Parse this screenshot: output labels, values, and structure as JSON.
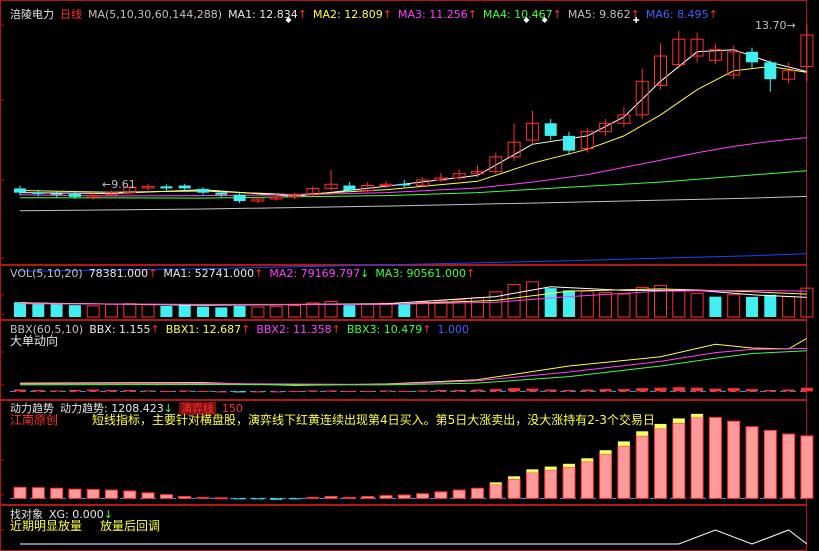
{
  "colors": {
    "bg": "#000000",
    "frame": "#b01818",
    "up": "#ff3030",
    "down": "#40f0f0",
    "ma1": "#ffffff",
    "ma2": "#ffff40",
    "ma3": "#ff40ff",
    "ma4": "#40ff40",
    "ma5": "#c0c0c0",
    "ma6": "#2040ff",
    "label_white": "#e8e8e8"
  },
  "price_panel": {
    "stock_name": "涪陵电力",
    "period": "日线",
    "ma_params": "MA(5,10,30,60,144,288)",
    "ma1": {
      "label": "MA1:",
      "value": "12.834",
      "arrow": "↑"
    },
    "ma2": {
      "label": "MA2:",
      "value": "12.809",
      "arrow": "↑"
    },
    "ma3": {
      "label": "MA3:",
      "value": "11.256",
      "arrow": "↑"
    },
    "ma4": {
      "label": "MA4:",
      "value": "10.467",
      "arrow": "↑"
    },
    "ma5": {
      "label": "MA5:",
      "value": "9.862",
      "arrow": "↑"
    },
    "ma6": {
      "label": "MA6:",
      "value": "8.495",
      "arrow": "↑"
    },
    "high_label": "13.70",
    "low_label": "9.61"
  },
  "vol_panel": {
    "params": "VOL(5,10,20)",
    "volume": "78381.000",
    "volume_arrow": "↑",
    "ma1": {
      "label": "MA1:",
      "value": "52741.000",
      "arrow": "↑"
    },
    "ma2": {
      "label": "MA2:",
      "value": "79169.797",
      "arrow": "↓"
    },
    "ma3": {
      "label": "MA3:",
      "value": "90561.000",
      "arrow": "↑"
    }
  },
  "bbx_panel": {
    "params": "BBX(60,5,10)",
    "bbx": {
      "label": "BBX:",
      "value": "1.155",
      "arrow": "↑"
    },
    "bbx1": {
      "label": "BBX1:",
      "value": "12.687",
      "arrow": "↑"
    },
    "bbx2": {
      "label": "BBX2:",
      "value": "11.358",
      "arrow": "↑"
    },
    "bbx3": {
      "label": "BBX3:",
      "value": "10.479",
      "arrow": "↑"
    },
    "level": "1.000",
    "caption": "大单动向"
  },
  "momentum_panel": {
    "title": "动力趋势",
    "indicator_label": "动力趋势:",
    "indicator_value": "1208.423",
    "indicator_arrow": "↓",
    "evolve_label": "演弈线",
    "evolve_value": "150",
    "brand": "江南原创",
    "description": "短线指标，主要针对横盘股，演弈线下红黄连续出现第4日买入。第5日大涨卖出，没大涨持有2-3个交易日"
  },
  "find_panel": {
    "title": "找对象",
    "xg_label": "XG:",
    "xg_value": "0.000",
    "xg_arrow": "↓",
    "caption1": "近期明显放量",
    "caption2": "放量后回调"
  },
  "chart_data": {
    "type": "candlestick",
    "price_range": [
      8.3,
      14.2
    ],
    "candles": [
      {
        "o": 10.05,
        "c": 9.95,
        "h": 10.12,
        "l": 9.88
      },
      {
        "o": 9.96,
        "c": 9.92,
        "h": 10.02,
        "l": 9.86
      },
      {
        "o": 9.93,
        "c": 9.9,
        "h": 9.98,
        "l": 9.84
      },
      {
        "o": 9.92,
        "c": 9.85,
        "h": 9.98,
        "l": 9.8
      },
      {
        "o": 9.84,
        "c": 9.88,
        "h": 9.95,
        "l": 9.78
      },
      {
        "o": 9.9,
        "c": 9.95,
        "h": 10.0,
        "l": 9.86
      },
      {
        "o": 9.95,
        "c": 10.08,
        "h": 10.12,
        "l": 9.9
      },
      {
        "o": 10.06,
        "c": 10.1,
        "h": 10.16,
        "l": 10.0
      },
      {
        "o": 10.1,
        "c": 10.05,
        "h": 10.15,
        "l": 9.98
      },
      {
        "o": 10.12,
        "c": 10.05,
        "h": 10.16,
        "l": 9.96
      },
      {
        "o": 10.04,
        "c": 9.95,
        "h": 10.08,
        "l": 9.9
      },
      {
        "o": 9.95,
        "c": 9.9,
        "h": 10.0,
        "l": 9.84
      },
      {
        "o": 9.9,
        "c": 9.75,
        "h": 9.94,
        "l": 9.7
      },
      {
        "o": 9.75,
        "c": 9.8,
        "h": 9.86,
        "l": 9.7
      },
      {
        "o": 9.8,
        "c": 9.85,
        "h": 9.92,
        "l": 9.76
      },
      {
        "o": 9.86,
        "c": 9.9,
        "h": 9.95,
        "l": 9.8
      },
      {
        "o": 9.9,
        "c": 10.05,
        "h": 10.1,
        "l": 9.86
      },
      {
        "o": 10.05,
        "c": 10.15,
        "h": 10.5,
        "l": 10.0
      },
      {
        "o": 10.12,
        "c": 10.0,
        "h": 10.2,
        "l": 9.96
      },
      {
        "o": 10.0,
        "c": 10.12,
        "h": 10.2,
        "l": 9.96
      },
      {
        "o": 10.12,
        "c": 10.15,
        "h": 10.22,
        "l": 10.05
      },
      {
        "o": 10.16,
        "c": 10.12,
        "h": 10.25,
        "l": 10.05
      },
      {
        "o": 10.12,
        "c": 10.25,
        "h": 10.32,
        "l": 10.08
      },
      {
        "o": 10.25,
        "c": 10.3,
        "h": 10.42,
        "l": 10.2
      },
      {
        "o": 10.3,
        "c": 10.4,
        "h": 10.5,
        "l": 10.25
      },
      {
        "o": 10.4,
        "c": 10.45,
        "h": 10.6,
        "l": 10.32
      },
      {
        "o": 10.45,
        "c": 10.8,
        "h": 10.9,
        "l": 10.4
      },
      {
        "o": 10.8,
        "c": 11.15,
        "h": 11.6,
        "l": 10.7
      },
      {
        "o": 11.2,
        "c": 11.6,
        "h": 11.9,
        "l": 11.1
      },
      {
        "o": 11.6,
        "c": 11.3,
        "h": 11.7,
        "l": 11.2
      },
      {
        "o": 11.3,
        "c": 10.95,
        "h": 11.4,
        "l": 10.85
      },
      {
        "o": 11.0,
        "c": 11.4,
        "h": 11.5,
        "l": 10.9
      },
      {
        "o": 11.4,
        "c": 11.6,
        "h": 11.7,
        "l": 11.3
      },
      {
        "o": 11.6,
        "c": 11.8,
        "h": 12.0,
        "l": 11.5
      },
      {
        "o": 11.8,
        "c": 12.6,
        "h": 12.9,
        "l": 11.7
      },
      {
        "o": 12.5,
        "c": 13.2,
        "h": 13.5,
        "l": 12.4
      },
      {
        "o": 13.0,
        "c": 13.6,
        "h": 13.8,
        "l": 12.9
      },
      {
        "o": 13.2,
        "c": 13.6,
        "h": 13.75,
        "l": 13.05
      },
      {
        "o": 13.1,
        "c": 13.35,
        "h": 13.5,
        "l": 13.0
      },
      {
        "o": 12.75,
        "c": 13.3,
        "h": 13.45,
        "l": 12.65
      },
      {
        "o": 13.3,
        "c": 13.05,
        "h": 13.4,
        "l": 12.9
      },
      {
        "o": 13.05,
        "c": 12.65,
        "h": 13.1,
        "l": 12.35
      },
      {
        "o": 12.65,
        "c": 12.85,
        "h": 13.05,
        "l": 12.55
      },
      {
        "o": 12.95,
        "c": 13.7,
        "h": 13.95,
        "l": 12.6
      }
    ],
    "ma_lines": [
      {
        "name": "MA1",
        "color": "#ffffff",
        "points": [
          [
            0,
            9.95
          ],
          [
            5,
            9.93
          ],
          [
            10,
            10.02
          ],
          [
            15,
            9.86
          ],
          [
            20,
            10.1
          ],
          [
            25,
            10.36
          ],
          [
            28,
            11.1
          ],
          [
            31,
            11.3
          ],
          [
            33,
            11.75
          ],
          [
            35,
            12.6
          ],
          [
            37,
            13.3
          ],
          [
            39,
            13.35
          ],
          [
            41,
            13.05
          ],
          [
            43,
            12.83
          ]
        ]
      },
      {
        "name": "MA2",
        "color": "#ffff40",
        "points": [
          [
            0,
            10.0
          ],
          [
            5,
            9.96
          ],
          [
            10,
            9.99
          ],
          [
            15,
            9.9
          ],
          [
            20,
            10.02
          ],
          [
            25,
            10.22
          ],
          [
            28,
            10.65
          ],
          [
            31,
            10.98
          ],
          [
            33,
            11.3
          ],
          [
            35,
            11.8
          ],
          [
            37,
            12.4
          ],
          [
            39,
            12.85
          ],
          [
            41,
            12.95
          ],
          [
            43,
            12.81
          ]
        ]
      },
      {
        "name": "MA3",
        "color": "#ff40ff",
        "points": [
          [
            0,
            9.9
          ],
          [
            5,
            9.87
          ],
          [
            10,
            9.88
          ],
          [
            15,
            9.9
          ],
          [
            20,
            9.95
          ],
          [
            25,
            10.06
          ],
          [
            28,
            10.2
          ],
          [
            31,
            10.38
          ],
          [
            33,
            10.55
          ],
          [
            35,
            10.72
          ],
          [
            37,
            10.9
          ],
          [
            39,
            11.05
          ],
          [
            41,
            11.17
          ],
          [
            43,
            11.26
          ]
        ]
      },
      {
        "name": "MA4",
        "color": "#40ff40",
        "points": [
          [
            0,
            9.83
          ],
          [
            10,
            9.82
          ],
          [
            20,
            9.88
          ],
          [
            25,
            9.95
          ],
          [
            30,
            10.08
          ],
          [
            35,
            10.2
          ],
          [
            40,
            10.37
          ],
          [
            43,
            10.47
          ]
        ]
      },
      {
        "name": "MA5",
        "color": "#c0c0c0",
        "points": [
          [
            0,
            9.52
          ],
          [
            10,
            9.56
          ],
          [
            20,
            9.63
          ],
          [
            30,
            9.72
          ],
          [
            40,
            9.82
          ],
          [
            43,
            9.86
          ]
        ]
      },
      {
        "name": "MA6",
        "color": "#2040ff",
        "points": [
          [
            0,
            8.08
          ],
          [
            10,
            8.14
          ],
          [
            20,
            8.23
          ],
          [
            30,
            8.33
          ],
          [
            40,
            8.45
          ],
          [
            43,
            8.5
          ]
        ]
      }
    ],
    "volume": [
      {
        "v": 40,
        "up": false
      },
      {
        "v": 38,
        "up": false
      },
      {
        "v": 35,
        "up": false
      },
      {
        "v": 32,
        "up": false
      },
      {
        "v": 30,
        "up": true
      },
      {
        "v": 34,
        "up": true
      },
      {
        "v": 36,
        "up": true
      },
      {
        "v": 33,
        "up": true
      },
      {
        "v": 30,
        "up": false
      },
      {
        "v": 34,
        "up": false
      },
      {
        "v": 28,
        "up": false
      },
      {
        "v": 26,
        "up": false
      },
      {
        "v": 30,
        "up": false
      },
      {
        "v": 27,
        "up": true
      },
      {
        "v": 29,
        "up": true
      },
      {
        "v": 31,
        "up": true
      },
      {
        "v": 38,
        "up": true
      },
      {
        "v": 42,
        "up": true
      },
      {
        "v": 32,
        "up": false
      },
      {
        "v": 35,
        "up": true
      },
      {
        "v": 37,
        "up": true
      },
      {
        "v": 36,
        "up": false
      },
      {
        "v": 40,
        "up": true
      },
      {
        "v": 43,
        "up": true
      },
      {
        "v": 46,
        "up": true
      },
      {
        "v": 52,
        "up": true
      },
      {
        "v": 68,
        "up": true
      },
      {
        "v": 88,
        "up": true
      },
      {
        "v": 95,
        "up": true
      },
      {
        "v": 78,
        "up": false
      },
      {
        "v": 72,
        "up": false
      },
      {
        "v": 70,
        "up": true
      },
      {
        "v": 66,
        "up": true
      },
      {
        "v": 62,
        "up": true
      },
      {
        "v": 80,
        "up": true
      },
      {
        "v": 85,
        "up": true
      },
      {
        "v": 70,
        "up": true
      },
      {
        "v": 64,
        "up": true
      },
      {
        "v": 55,
        "up": false
      },
      {
        "v": 60,
        "up": true
      },
      {
        "v": 54,
        "up": false
      },
      {
        "v": 60,
        "up": false
      },
      {
        "v": 55,
        "up": true
      },
      {
        "v": 78,
        "up": true
      }
    ],
    "vol_ma": [
      {
        "color": "#ffffff",
        "points": [
          [
            0,
            38
          ],
          [
            10,
            32
          ],
          [
            20,
            36
          ],
          [
            26,
            55
          ],
          [
            29,
            82
          ],
          [
            33,
            72
          ],
          [
            37,
            72
          ],
          [
            40,
            60
          ],
          [
            43,
            53
          ]
        ]
      },
      {
        "color": "#ffff40",
        "points": [
          [
            0,
            37
          ],
          [
            10,
            33
          ],
          [
            20,
            34
          ],
          [
            26,
            45
          ],
          [
            30,
            70
          ],
          [
            35,
            76
          ],
          [
            40,
            68
          ],
          [
            43,
            62
          ]
        ]
      },
      {
        "color": "#ff40ff",
        "points": [
          [
            0,
            36
          ],
          [
            10,
            34
          ],
          [
            20,
            34
          ],
          [
            26,
            40
          ],
          [
            30,
            55
          ],
          [
            35,
            70
          ],
          [
            40,
            72
          ],
          [
            43,
            70
          ]
        ]
      }
    ],
    "bbx_lines": [
      {
        "color": "#ffff40",
        "points": [
          [
            0,
            1.8
          ],
          [
            10,
            1.9
          ],
          [
            15,
            1.3
          ],
          [
            20,
            1.6
          ],
          [
            25,
            2.5
          ],
          [
            30,
            5.5
          ],
          [
            35,
            7.5
          ],
          [
            38,
            10.2
          ],
          [
            40,
            9.4
          ],
          [
            42,
            9.2
          ],
          [
            43,
            11.5
          ]
        ]
      },
      {
        "color": "#ff40ff",
        "points": [
          [
            0,
            1.6
          ],
          [
            10,
            1.7
          ],
          [
            20,
            1.5
          ],
          [
            25,
            2.3
          ],
          [
            30,
            4.2
          ],
          [
            35,
            6.5
          ],
          [
            38,
            8.4
          ],
          [
            40,
            9.1
          ],
          [
            43,
            9.3
          ]
        ]
      },
      {
        "color": "#40ff40",
        "points": [
          [
            0,
            1.4
          ],
          [
            10,
            1.5
          ],
          [
            20,
            1.4
          ],
          [
            25,
            1.8
          ],
          [
            30,
            3.2
          ],
          [
            35,
            5.5
          ],
          [
            38,
            7.2
          ],
          [
            40,
            8.2
          ],
          [
            43,
            8.8
          ]
        ]
      }
    ],
    "bbx_bars": [
      0.4,
      0.3,
      0.2,
      0.3,
      0.4,
      0.3,
      0.3,
      0.2,
      0.1,
      0.2,
      0.1,
      0.0,
      -0.1,
      0.0,
      0.0,
      0.1,
      0.2,
      0.2,
      0.1,
      0.1,
      0.2,
      0.1,
      0.2,
      0.3,
      0.3,
      0.4,
      0.5,
      0.7,
      0.6,
      0.4,
      0.3,
      0.4,
      0.5,
      0.5,
      0.7,
      0.8,
      0.9,
      0.8,
      0.6,
      0.7,
      0.5,
      0.3,
      0.4,
      0.8
    ],
    "momentum_bars": [
      {
        "r": 60,
        "y": 0
      },
      {
        "r": 58,
        "y": 0
      },
      {
        "r": 55,
        "y": 0
      },
      {
        "r": 50,
        "y": 0
      },
      {
        "r": 48,
        "y": 0
      },
      {
        "r": 45,
        "y": 0
      },
      {
        "r": 40,
        "y": 0
      },
      {
        "r": 30,
        "y": 0
      },
      {
        "r": 20,
        "y": 0
      },
      {
        "r": 10,
        "y": 0
      },
      {
        "r": 5,
        "y": 0
      },
      {
        "r": 3,
        "y": 0
      },
      {
        "r": -5,
        "y": 0
      },
      {
        "r": -3,
        "y": 0
      },
      {
        "r": -8,
        "y": 0
      },
      {
        "r": -5,
        "y": 0
      },
      {
        "r": 5,
        "y": 0
      },
      {
        "r": 10,
        "y": 0
      },
      {
        "r": 5,
        "y": 0
      },
      {
        "r": 10,
        "y": 0
      },
      {
        "r": 15,
        "y": 0
      },
      {
        "r": 18,
        "y": 0
      },
      {
        "r": 25,
        "y": 0
      },
      {
        "r": 35,
        "y": 0
      },
      {
        "r": 45,
        "y": 0
      },
      {
        "r": 55,
        "y": 0
      },
      {
        "r": 75,
        "y": 12
      },
      {
        "r": 105,
        "y": 15
      },
      {
        "r": 140,
        "y": 18
      },
      {
        "r": 155,
        "y": 18
      },
      {
        "r": 170,
        "y": 18
      },
      {
        "r": 200,
        "y": 18
      },
      {
        "r": 240,
        "y": 22
      },
      {
        "r": 285,
        "y": 25
      },
      {
        "r": 340,
        "y": 25
      },
      {
        "r": 380,
        "y": 25
      },
      {
        "r": 410,
        "y": 25
      },
      {
        "r": 440,
        "y": 20
      },
      {
        "r": 440,
        "y": 0
      },
      {
        "r": 420,
        "y": 0
      },
      {
        "r": 390,
        "y": 0
      },
      {
        "r": 370,
        "y": 0
      },
      {
        "r": 350,
        "y": 0
      },
      {
        "r": 340,
        "y": 0
      }
    ],
    "xg_line": [
      [
        0,
        0
      ],
      [
        36,
        0
      ],
      [
        38,
        1
      ],
      [
        40,
        0
      ],
      [
        42,
        1
      ],
      [
        43,
        0
      ]
    ]
  }
}
